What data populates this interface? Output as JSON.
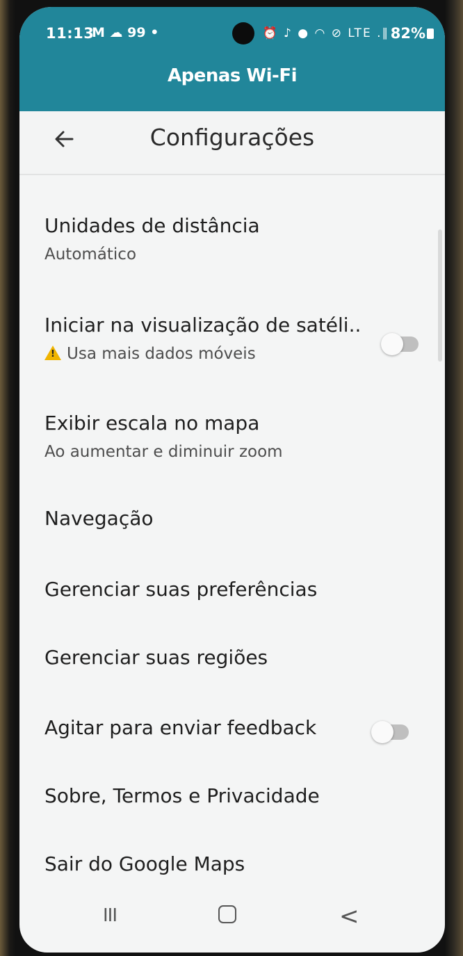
{
  "status_bar": {
    "time": "11:13",
    "notif_icons": "M ☁ 99 •",
    "sys_icons": "⏰ ♪ ● ◠ ⊘ LTE .∥",
    "battery": "82%"
  },
  "banner": {
    "text": "Apenas Wi-Fi"
  },
  "app_bar": {
    "title": "Configurações",
    "back_icon": "arrow-left-icon"
  },
  "settings": [
    {
      "title": "Unidades de distância",
      "subtitle": "Automático"
    },
    {
      "title": "Iniciar na visualização de satéli..",
      "subtitle": "Usa mais dados móveis",
      "toggle": "off"
    },
    {
      "title": "Exibir escala no mapa",
      "subtitle": "Ao aumentar e diminuir zoom"
    },
    {
      "title": "Navegação"
    },
    {
      "title": "Gerenciar suas preferências"
    },
    {
      "title": "Gerenciar suas regiões"
    },
    {
      "title": "Agitar para enviar feedback",
      "toggle": "off"
    },
    {
      "title": "Sobre, Termos e Privacidade"
    },
    {
      "title": "Sair do Google Maps"
    }
  ],
  "nav": {
    "recents": "III",
    "back": "<"
  },
  "colors": {
    "status_bar": "#21869a",
    "background": "#f4f5f5",
    "text": "#1e1e1e"
  }
}
